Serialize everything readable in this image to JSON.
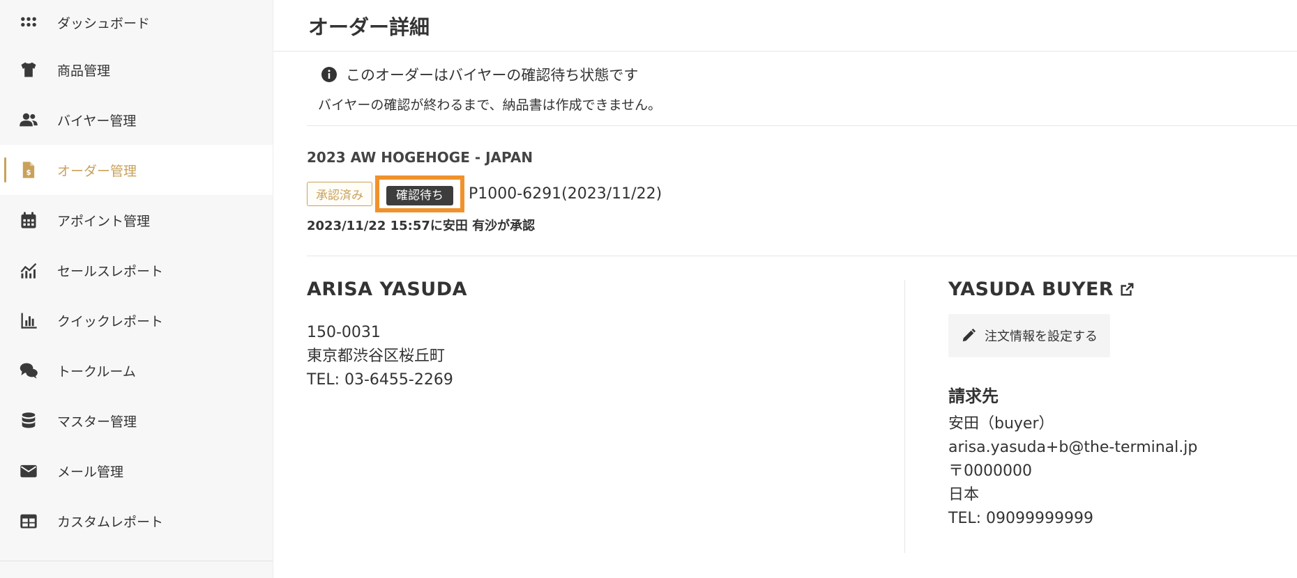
{
  "sidebar": {
    "items": [
      {
        "label": "ダッシュボード",
        "icon": "grid-icon"
      },
      {
        "label": "商品管理",
        "icon": "tshirt-icon"
      },
      {
        "label": "バイヤー管理",
        "icon": "users-icon"
      },
      {
        "label": "オーダー管理",
        "icon": "invoice-icon"
      },
      {
        "label": "アポイント管理",
        "icon": "calendar-icon"
      },
      {
        "label": "セールスレポート",
        "icon": "chart-line-icon"
      },
      {
        "label": "クイックレポート",
        "icon": "chart-bar-icon"
      },
      {
        "label": "トークルーム",
        "icon": "chat-icon"
      },
      {
        "label": "マスター管理",
        "icon": "database-icon"
      },
      {
        "label": "メール管理",
        "icon": "envelope-icon"
      },
      {
        "label": "カスタムレポート",
        "icon": "table-icon"
      }
    ],
    "active_index": 3
  },
  "colors": {
    "accent": "#c9a15a",
    "highlight": "#f0922b",
    "dark_badge": "#3d3d3d"
  },
  "page": {
    "title": "オーダー詳細"
  },
  "notice": {
    "line1": "このオーダーはバイヤーの確認待ち状態です",
    "line2": "バイヤーの確認が終わるまで、納品書は作成できません。"
  },
  "order": {
    "collection": "2023 AW HOGEHOGE - JAPAN",
    "badge_approved": "承認済み",
    "badge_pending": "確認待ち",
    "number": "P1000-6291(2023/11/22)",
    "approval": "2023/11/22 15:57に安田 有沙が承認"
  },
  "customer": {
    "name": "ARISA YASUDA",
    "postal": "150-0031",
    "address": "東京都渋谷区桜丘町",
    "tel": "TEL: 03-6455-2269"
  },
  "buyer": {
    "name": "YASUDA BUYER",
    "settings_button": "注文情報を設定する",
    "billing_heading": "請求先",
    "billing_name": "安田（buyer）",
    "billing_email": "arisa.yasuda+b@the-terminal.jp",
    "billing_postal": "〒0000000",
    "billing_country": "日本",
    "billing_tel": "TEL: 09099999999"
  }
}
